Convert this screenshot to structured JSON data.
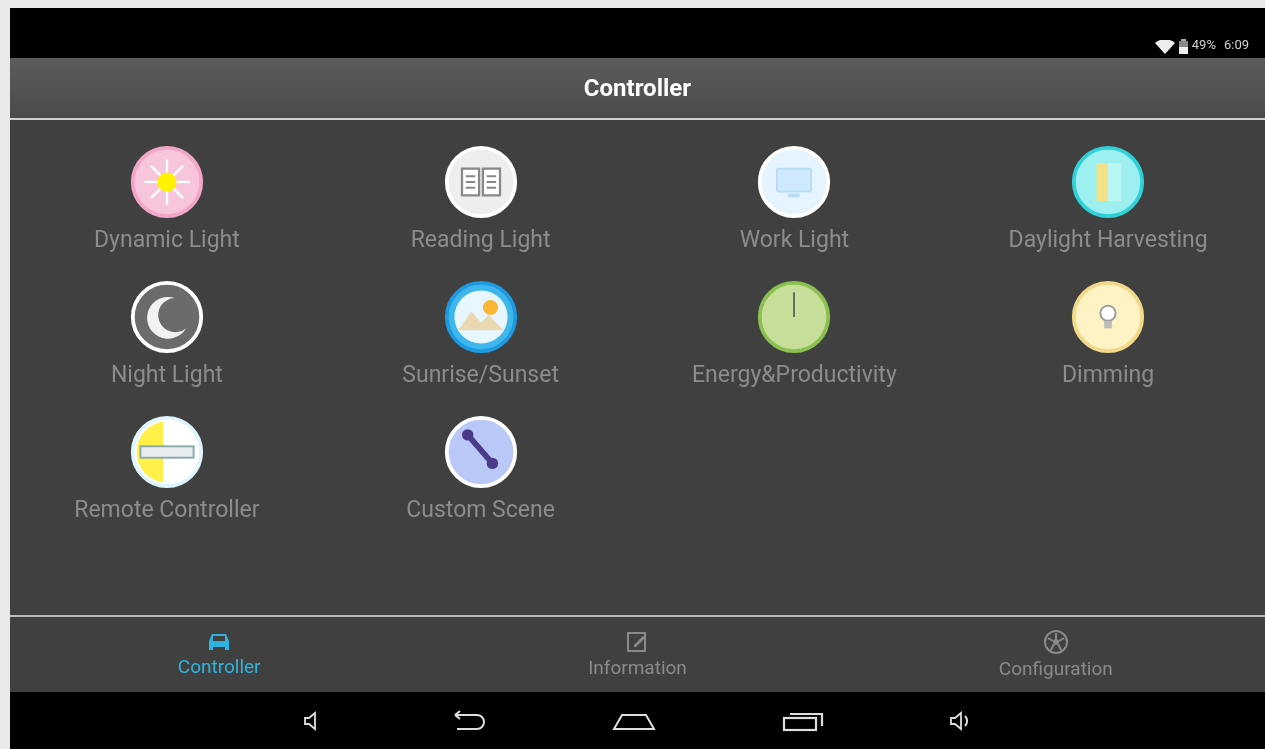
{
  "status_bar": {
    "battery": "49%",
    "time": "6:09"
  },
  "title": "Controller",
  "scenes": [
    {
      "label": "Dynamic Light"
    },
    {
      "label": "Reading Light"
    },
    {
      "label": "Work Light"
    },
    {
      "label": "Daylight Harvesting"
    },
    {
      "label": "Night Light"
    },
    {
      "label": "Sunrise/Sunset"
    },
    {
      "label": "Energy&Productivity"
    },
    {
      "label": "Dimming"
    },
    {
      "label": "Remote Controller"
    },
    {
      "label": "Custom Scene"
    }
  ],
  "tabs": [
    {
      "label": "Controller",
      "selected": true
    },
    {
      "label": "Information",
      "selected": false
    },
    {
      "label": "Configuration",
      "selected": false
    }
  ]
}
